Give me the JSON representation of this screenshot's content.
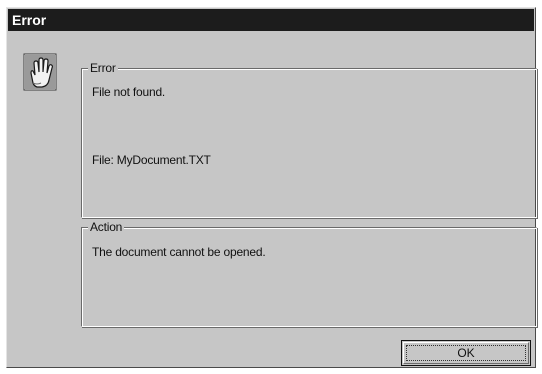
{
  "window": {
    "title": "Error"
  },
  "icon": "stop-hand-icon",
  "error_group": {
    "legend": "Error",
    "message": "File not found.",
    "file_line": "File: MyDocument.TXT"
  },
  "action_group": {
    "legend": "Action",
    "message": "The document cannot be opened."
  },
  "buttons": {
    "ok_label": "OK"
  },
  "colors": {
    "face": "#c6c6c6",
    "titlebar": "#1c1c1c",
    "title_text": "#ffffff"
  }
}
